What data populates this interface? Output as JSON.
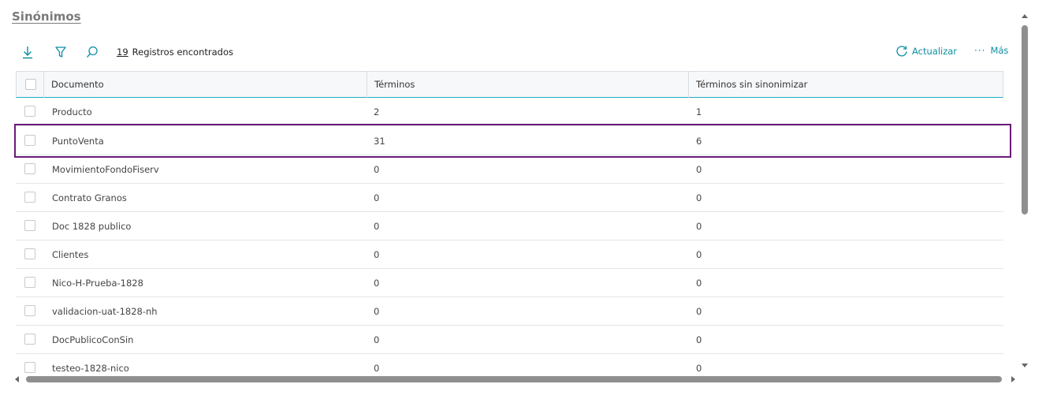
{
  "page": {
    "title": "Sinónimos"
  },
  "toolbar": {
    "download_icon": "download-icon",
    "filter_icon": "filter-icon",
    "search_icon": "search-icon",
    "count": "19",
    "count_label": "Registros encontrados",
    "refresh_label": "Actualizar",
    "more_label": "Más",
    "accent": "#0e8fa3"
  },
  "grid": {
    "columns": [
      "Documento",
      "Términos",
      "Términos sin sinonimizar"
    ],
    "rows": [
      {
        "documento": "Producto",
        "terminos": "2",
        "sin_sinonimizar": "1"
      },
      {
        "documento": "PuntoVenta",
        "terminos": "31",
        "sin_sinonimizar": "6"
      },
      {
        "documento": "MovimientoFondoFiserv",
        "terminos": "0",
        "sin_sinonimizar": "0"
      },
      {
        "documento": "Contrato Granos",
        "terminos": "0",
        "sin_sinonimizar": "0"
      },
      {
        "documento": "Doc 1828 publico",
        "terminos": "0",
        "sin_sinonimizar": "0"
      },
      {
        "documento": "Clientes",
        "terminos": "0",
        "sin_sinonimizar": "0"
      },
      {
        "documento": "Nico-H-Prueba-1828",
        "terminos": "0",
        "sin_sinonimizar": "0"
      },
      {
        "documento": "validacion-uat-1828-nh",
        "terminos": "0",
        "sin_sinonimizar": "0"
      },
      {
        "documento": "DocPublicoConSin",
        "terminos": "0",
        "sin_sinonimizar": "0"
      },
      {
        "documento": "testeo-1828-nico",
        "terminos": "0",
        "sin_sinonimizar": "0"
      }
    ],
    "highlight_color": "#6b1a7a"
  }
}
